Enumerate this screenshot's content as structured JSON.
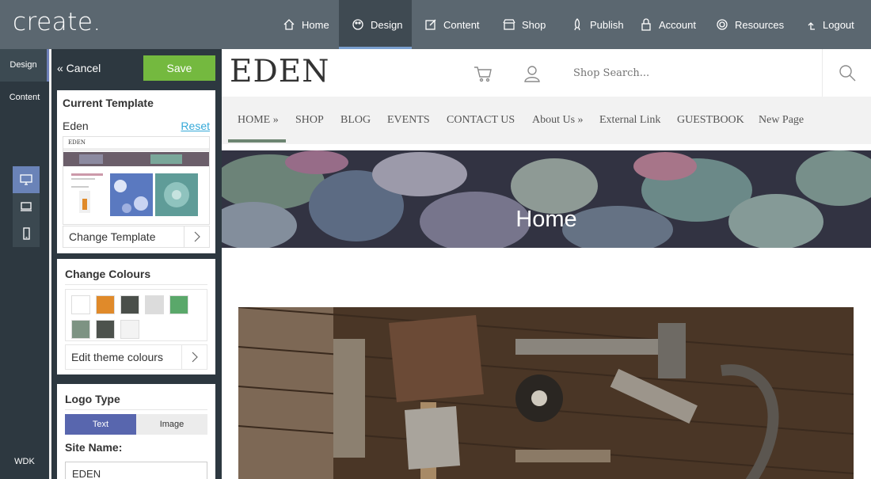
{
  "app": {
    "logo": "create."
  },
  "topnav": [
    {
      "label": "Home",
      "icon": "home-icon"
    },
    {
      "label": "Design",
      "icon": "palette-icon",
      "active": true
    },
    {
      "label": "Content",
      "icon": "edit-icon"
    },
    {
      "label": "Shop",
      "icon": "shop-icon"
    },
    {
      "label": "Publish",
      "icon": "rocket-icon"
    },
    {
      "label": "Account",
      "icon": "lock-icon"
    },
    {
      "label": "Resources",
      "icon": "lifebuoy-icon"
    },
    {
      "label": "Logout",
      "icon": "logout-icon"
    }
  ],
  "rail": {
    "design": "Design",
    "content": "Content",
    "wdk": "WDK"
  },
  "panel": {
    "cancel": "« Cancel",
    "save": "Save",
    "current_template": {
      "heading": "Current Template",
      "name": "Eden",
      "reset": "Reset",
      "change": "Change Template"
    },
    "colours": {
      "heading": "Change Colours",
      "swatches": [
        "#ffffff",
        "#e08a2a",
        "#4a4f4a",
        "#dcdcdc",
        "#5aa86a",
        "#7d9383",
        "#4d524d",
        "#f3f3f3"
      ],
      "edit": "Edit theme colours"
    },
    "logo_type": {
      "heading": "Logo Type",
      "options": [
        "Text",
        "Image"
      ],
      "site_name_label": "Site Name:",
      "site_name_value": "EDEN"
    }
  },
  "site": {
    "brand": "EDEN",
    "search_placeholder": "Shop Search...",
    "nav": [
      "HOME »",
      "SHOP",
      "BLOG",
      "EVENTS",
      "CONTACT US",
      "About Us »",
      "External Link",
      "GUESTBOOK",
      "New Page"
    ],
    "hero_title": "Home"
  }
}
